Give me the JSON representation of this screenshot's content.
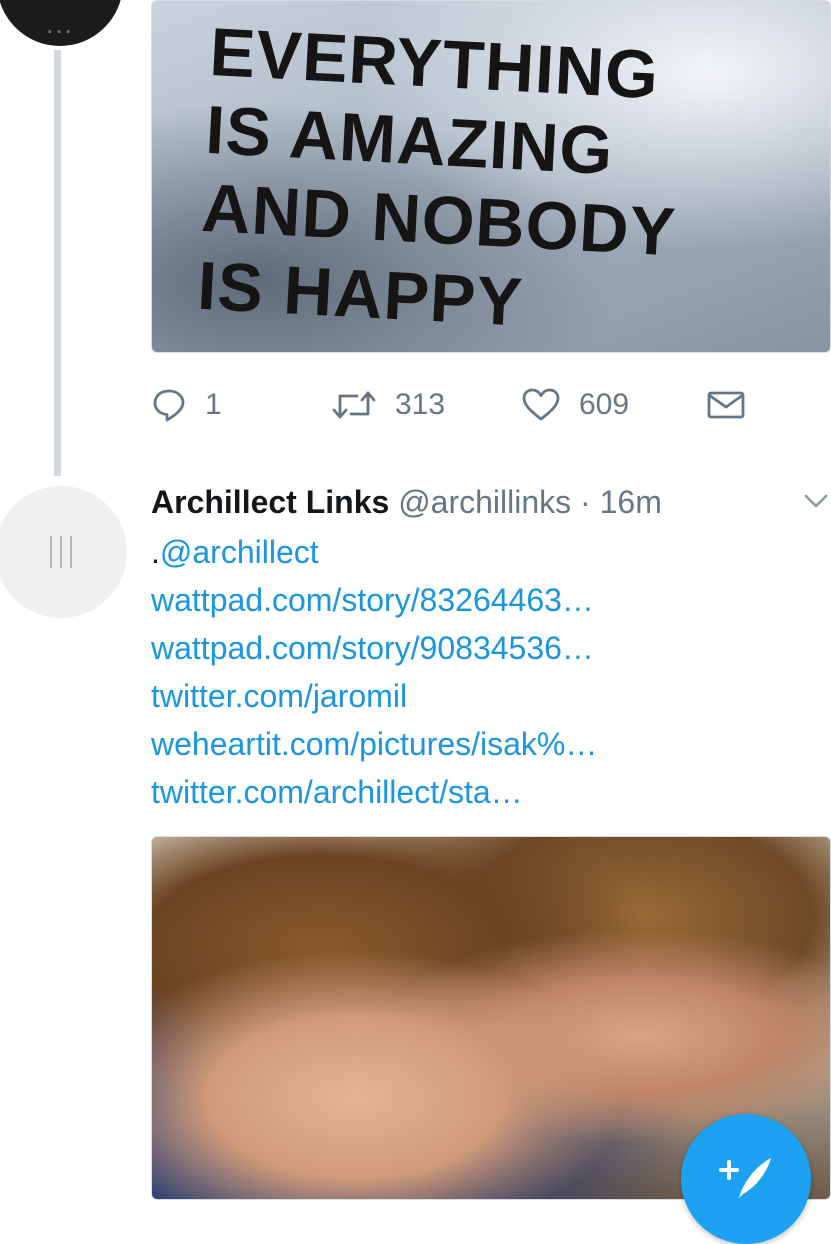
{
  "tweet1": {
    "shirt_text": [
      "EVERYTHING",
      "IS AMAZING",
      "AND NOBODY",
      "IS HAPPY"
    ],
    "avatar_dots": "...",
    "actions": {
      "reply_count": "1",
      "retweet_count": "313",
      "like_count": "609"
    }
  },
  "tweet2": {
    "author_name": "Archillect Links",
    "handle": "@archillinks",
    "separator": "·",
    "time": "16m",
    "body_lines": [
      {
        "prefix": ".",
        "text": "@archillect"
      },
      {
        "text": "wattpad.com/story/83264463…"
      },
      {
        "text": "wattpad.com/story/90834536…"
      },
      {
        "text": "twitter.com/jaromil"
      },
      {
        "text": "weheartit.com/pictures/isak%…"
      },
      {
        "text": "twitter.com/archillect/sta…"
      }
    ]
  },
  "icons": {
    "reply": "reply-icon",
    "retweet": "retweet-icon",
    "like": "heart-icon",
    "dm": "envelope-icon",
    "more": "chevron-down-icon",
    "compose": "compose-icon"
  },
  "colors": {
    "link": "#1b95e0",
    "muted": "#657786",
    "fab": "#1da1f2",
    "thread_line": "#cfd9de"
  }
}
